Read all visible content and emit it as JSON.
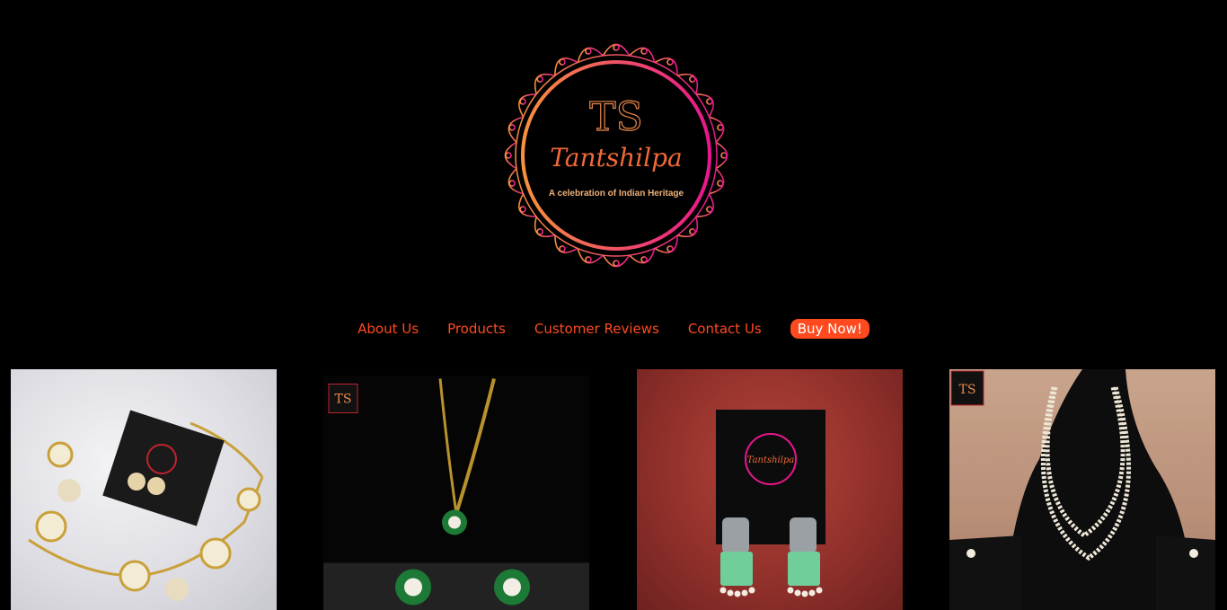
{
  "brand": {
    "monogram": "TS",
    "name": "Tantshilpa",
    "tagline": "A celebration of Indian Heritage",
    "gradient_start": "#f7913c",
    "gradient_end": "#e9168e"
  },
  "nav": {
    "items": [
      {
        "label": "About Us"
      },
      {
        "label": "Products"
      },
      {
        "label": "Customer Reviews"
      },
      {
        "label": "Contact Us"
      }
    ],
    "buy_label": "Buy Now!",
    "accent": "#ff4a1f"
  },
  "gallery": {
    "items": [
      {
        "subject": "gold pearl flower necklace with earrings card"
      },
      {
        "subject": "green pearl pendant chain with stud earrings"
      },
      {
        "subject": "green stone jhumka earrings on branded card"
      },
      {
        "subject": "triple strand pearl necklace on black display stand"
      }
    ]
  }
}
